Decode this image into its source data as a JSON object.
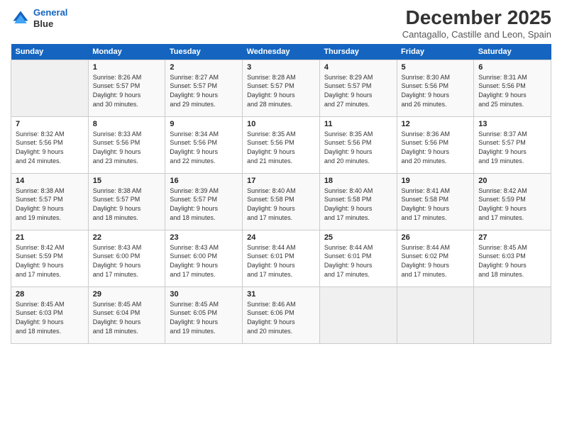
{
  "header": {
    "logo_line1": "General",
    "logo_line2": "Blue",
    "title": "December 2025",
    "subtitle": "Cantagallo, Castille and Leon, Spain"
  },
  "days_of_week": [
    "Sunday",
    "Monday",
    "Tuesday",
    "Wednesday",
    "Thursday",
    "Friday",
    "Saturday"
  ],
  "weeks": [
    [
      {
        "day": "",
        "info": ""
      },
      {
        "day": "1",
        "info": "Sunrise: 8:26 AM\nSunset: 5:57 PM\nDaylight: 9 hours\nand 30 minutes."
      },
      {
        "day": "2",
        "info": "Sunrise: 8:27 AM\nSunset: 5:57 PM\nDaylight: 9 hours\nand 29 minutes."
      },
      {
        "day": "3",
        "info": "Sunrise: 8:28 AM\nSunset: 5:57 PM\nDaylight: 9 hours\nand 28 minutes."
      },
      {
        "day": "4",
        "info": "Sunrise: 8:29 AM\nSunset: 5:57 PM\nDaylight: 9 hours\nand 27 minutes."
      },
      {
        "day": "5",
        "info": "Sunrise: 8:30 AM\nSunset: 5:56 PM\nDaylight: 9 hours\nand 26 minutes."
      },
      {
        "day": "6",
        "info": "Sunrise: 8:31 AM\nSunset: 5:56 PM\nDaylight: 9 hours\nand 25 minutes."
      }
    ],
    [
      {
        "day": "7",
        "info": "Sunrise: 8:32 AM\nSunset: 5:56 PM\nDaylight: 9 hours\nand 24 minutes."
      },
      {
        "day": "8",
        "info": "Sunrise: 8:33 AM\nSunset: 5:56 PM\nDaylight: 9 hours\nand 23 minutes."
      },
      {
        "day": "9",
        "info": "Sunrise: 8:34 AM\nSunset: 5:56 PM\nDaylight: 9 hours\nand 22 minutes."
      },
      {
        "day": "10",
        "info": "Sunrise: 8:35 AM\nSunset: 5:56 PM\nDaylight: 9 hours\nand 21 minutes."
      },
      {
        "day": "11",
        "info": "Sunrise: 8:35 AM\nSunset: 5:56 PM\nDaylight: 9 hours\nand 20 minutes."
      },
      {
        "day": "12",
        "info": "Sunrise: 8:36 AM\nSunset: 5:56 PM\nDaylight: 9 hours\nand 20 minutes."
      },
      {
        "day": "13",
        "info": "Sunrise: 8:37 AM\nSunset: 5:57 PM\nDaylight: 9 hours\nand 19 minutes."
      }
    ],
    [
      {
        "day": "14",
        "info": "Sunrise: 8:38 AM\nSunset: 5:57 PM\nDaylight: 9 hours\nand 19 minutes."
      },
      {
        "day": "15",
        "info": "Sunrise: 8:38 AM\nSunset: 5:57 PM\nDaylight: 9 hours\nand 18 minutes."
      },
      {
        "day": "16",
        "info": "Sunrise: 8:39 AM\nSunset: 5:57 PM\nDaylight: 9 hours\nand 18 minutes."
      },
      {
        "day": "17",
        "info": "Sunrise: 8:40 AM\nSunset: 5:58 PM\nDaylight: 9 hours\nand 17 minutes."
      },
      {
        "day": "18",
        "info": "Sunrise: 8:40 AM\nSunset: 5:58 PM\nDaylight: 9 hours\nand 17 minutes."
      },
      {
        "day": "19",
        "info": "Sunrise: 8:41 AM\nSunset: 5:58 PM\nDaylight: 9 hours\nand 17 minutes."
      },
      {
        "day": "20",
        "info": "Sunrise: 8:42 AM\nSunset: 5:59 PM\nDaylight: 9 hours\nand 17 minutes."
      }
    ],
    [
      {
        "day": "21",
        "info": "Sunrise: 8:42 AM\nSunset: 5:59 PM\nDaylight: 9 hours\nand 17 minutes."
      },
      {
        "day": "22",
        "info": "Sunrise: 8:43 AM\nSunset: 6:00 PM\nDaylight: 9 hours\nand 17 minutes."
      },
      {
        "day": "23",
        "info": "Sunrise: 8:43 AM\nSunset: 6:00 PM\nDaylight: 9 hours\nand 17 minutes."
      },
      {
        "day": "24",
        "info": "Sunrise: 8:44 AM\nSunset: 6:01 PM\nDaylight: 9 hours\nand 17 minutes."
      },
      {
        "day": "25",
        "info": "Sunrise: 8:44 AM\nSunset: 6:01 PM\nDaylight: 9 hours\nand 17 minutes."
      },
      {
        "day": "26",
        "info": "Sunrise: 8:44 AM\nSunset: 6:02 PM\nDaylight: 9 hours\nand 17 minutes."
      },
      {
        "day": "27",
        "info": "Sunrise: 8:45 AM\nSunset: 6:03 PM\nDaylight: 9 hours\nand 18 minutes."
      }
    ],
    [
      {
        "day": "28",
        "info": "Sunrise: 8:45 AM\nSunset: 6:03 PM\nDaylight: 9 hours\nand 18 minutes."
      },
      {
        "day": "29",
        "info": "Sunrise: 8:45 AM\nSunset: 6:04 PM\nDaylight: 9 hours\nand 18 minutes."
      },
      {
        "day": "30",
        "info": "Sunrise: 8:45 AM\nSunset: 6:05 PM\nDaylight: 9 hours\nand 19 minutes."
      },
      {
        "day": "31",
        "info": "Sunrise: 8:46 AM\nSunset: 6:06 PM\nDaylight: 9 hours\nand 20 minutes."
      },
      {
        "day": "",
        "info": ""
      },
      {
        "day": "",
        "info": ""
      },
      {
        "day": "",
        "info": ""
      }
    ]
  ]
}
